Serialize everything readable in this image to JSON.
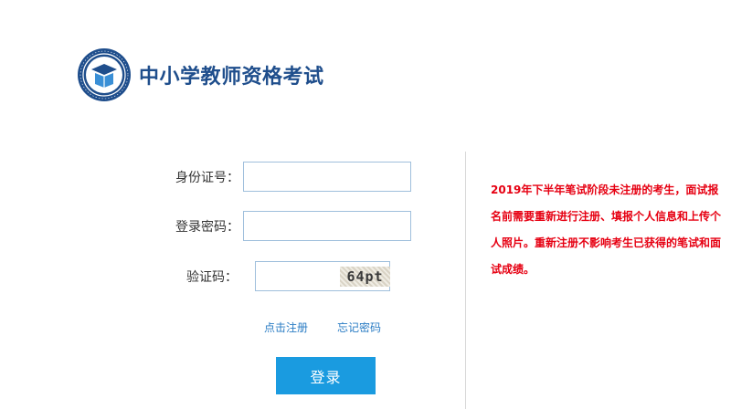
{
  "header": {
    "logo_icon": "teacher-qualification-emblem-icon",
    "site_title": "中小学教师资格考试"
  },
  "login_form": {
    "id_label": "身份证号：",
    "id_value": "",
    "password_label": "登录密码：",
    "password_value": "",
    "captcha_label": "验证码：",
    "captcha_value": "",
    "captcha_image_text": "64pt",
    "register_link": "点击注册",
    "forgot_password_link": "忘记密码",
    "login_button": "登录"
  },
  "notice": {
    "text": "2019年下半年笔试阶段未注册的考生，面试报名前需要重新进行注册、填报个人信息和上传个人照片。重新注册不影响考生已获得的笔试和面试成绩。"
  },
  "colors": {
    "brand_blue": "#1f4e8c",
    "button_blue": "#1a9be0",
    "link_blue": "#2a7cc4",
    "notice_red": "#e60012",
    "input_border": "#9fbfdc"
  }
}
